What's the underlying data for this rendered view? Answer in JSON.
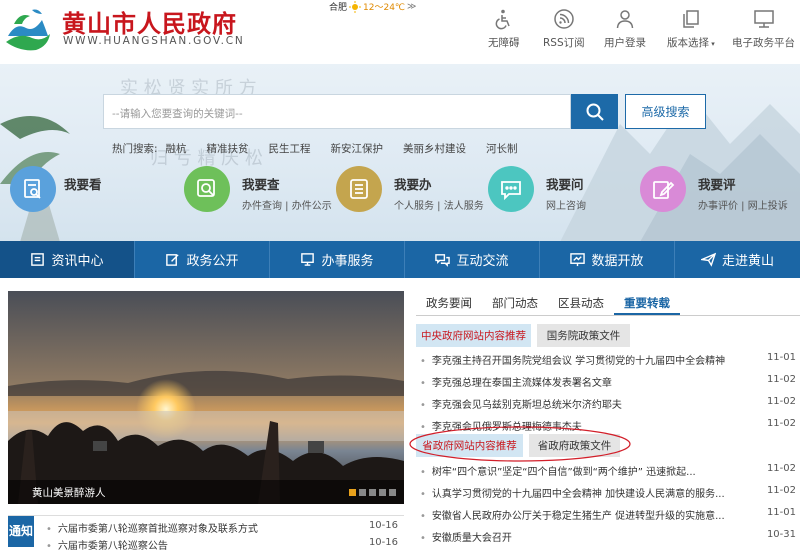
{
  "header": {
    "title": "黄山市人民政府",
    "url": "WWW.HUANGSHAN.GOV.CN",
    "weather_city": "合肥",
    "weather_temp": "12～24℃",
    "weather_more": "≫",
    "tools": [
      {
        "label": "无障碍",
        "icon": "accessibility-icon"
      },
      {
        "label": "RSS订阅",
        "icon": "rss-icon"
      },
      {
        "label": "用户登录",
        "icon": "user-icon"
      },
      {
        "label": "版本选择",
        "icon": "copy-icon"
      },
      {
        "label": "电子政务平台",
        "icon": "monitor-icon"
      }
    ]
  },
  "search": {
    "placeholder": "--请输入您要查询的关键词--",
    "advanced_label": "高级搜索"
  },
  "hot": {
    "label": "热门搜索:",
    "items": [
      "融杭",
      "精准扶贫",
      "民生工程",
      "新安江保护",
      "美丽乡村建设",
      "河长制"
    ]
  },
  "services": [
    {
      "title": "我要看",
      "sub": ""
    },
    {
      "title": "我要查",
      "sub": "办件查询 | 办件公示"
    },
    {
      "title": "我要办",
      "sub": "个人服务 | 法人服务"
    },
    {
      "title": "我要问",
      "sub": "网上咨询"
    },
    {
      "title": "我要评",
      "sub": "办事评价 | 网上投诉"
    }
  ],
  "nav": [
    "资讯中心",
    "政务公开",
    "办事服务",
    "互动交流",
    "数据开放",
    "走进黄山"
  ],
  "photo": {
    "caption": "黄山美景醉游人"
  },
  "notice": {
    "tab": "通知",
    "items": [
      {
        "title": "六届市委第八轮巡察首批巡察对象及联系方式",
        "date": "10-16"
      },
      {
        "title": "六届市委第八轮巡察公告",
        "date": "10-16"
      }
    ]
  },
  "news": {
    "tabs": [
      "政务要闻",
      "部门动态",
      "区县动态",
      "重要转载"
    ],
    "sub1": [
      "中央政府网站内容推荐",
      "国务院政策文件"
    ],
    "items1": [
      {
        "title": "李克强主持召开国务院党组会议 学习贯彻党的十九届四中全会精神",
        "date": "11-01"
      },
      {
        "title": "李克强总理在泰国主流媒体发表署名文章",
        "date": "11-02"
      },
      {
        "title": "李克强会见乌兹别克斯坦总统米尔济约耶夫",
        "date": "11-02"
      },
      {
        "title": "李克强会见俄罗斯总理梅德韦杰夫",
        "date": "11-02"
      }
    ],
    "sub2": [
      "省政府网站内容推荐",
      "省政府政策文件"
    ],
    "items2": [
      {
        "title": "树牢“四个意识”坚定“四个自信”做到“两个维护” 迅速掀起...",
        "date": "11-02"
      },
      {
        "title": "认真学习贯彻党的十九届四中全会精神 加快建设人民满意的服务...",
        "date": "11-02"
      },
      {
        "title": "安徽省人民政府办公厅关于稳定生猪生产 促进转型升级的实施意...",
        "date": "11-01"
      },
      {
        "title": "安徽质量大会召开",
        "date": "10-31"
      }
    ]
  },
  "colors": {
    "brand_red": "#c8161d",
    "nav_blue": "#1b66a5",
    "svc1": "#5aa1dc",
    "svc2": "#6ec05a",
    "svc3": "#c4a54e",
    "svc4": "#4cc6c0",
    "svc5": "#d98ad7"
  }
}
